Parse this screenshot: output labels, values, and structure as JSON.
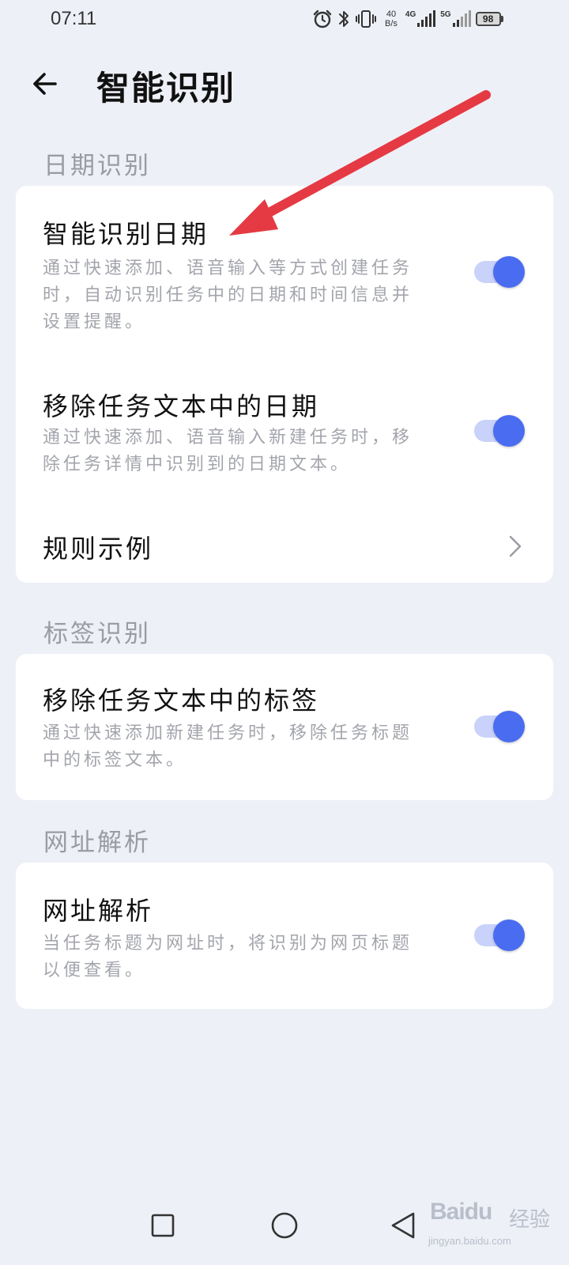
{
  "status_bar": {
    "time": "07:11",
    "netspeed_value": "40",
    "netspeed_unit": "B/s",
    "sim1_label": "4G",
    "sim2_label": "5G",
    "battery": "98",
    "icons": [
      "alarm-icon",
      "bluetooth-icon",
      "vibrate-icon",
      "signal-icon",
      "battery-icon"
    ]
  },
  "header": {
    "back_icon": "arrow-left-icon",
    "title": "智能识别"
  },
  "sections": {
    "date": {
      "label": "日期识别",
      "items": [
        {
          "title": "智能识别日期",
          "desc": "通过快速添加、语音输入等方式创建任务时，自动识别任务中的日期和时间信息并设置提醒。",
          "toggle_on": true
        },
        {
          "title": "移除任务文本中的日期",
          "desc": "通过快速添加、语音输入新建任务时，移除任务详情中识别到的日期文本。",
          "toggle_on": true
        },
        {
          "title": "规则示例",
          "chevron_icon": "chevron-right-icon"
        }
      ]
    },
    "tag": {
      "label": "标签识别",
      "items": [
        {
          "title": "移除任务文本中的标签",
          "desc": "通过快速添加新建任务时，移除任务标题中的标签文本。",
          "toggle_on": true
        }
      ]
    },
    "url": {
      "label": "网址解析",
      "items": [
        {
          "title": "网址解析",
          "desc": "当任务标题为网址时，将识别为网页标题以便查看。",
          "toggle_on": true
        }
      ]
    }
  },
  "colors": {
    "background": "#eef0f7",
    "card": "#ffffff",
    "toggle_knob": "#4a6cf0",
    "toggle_track": "#c9d2fa",
    "annotation_arrow": "#e53a43"
  },
  "nav_bar": {
    "icons": [
      "recents-square-icon",
      "home-circle-icon",
      "back-triangle-icon"
    ]
  },
  "watermark": {
    "brand": "Baidu",
    "cn": "经验",
    "url": "jingyan.baidu.com"
  }
}
